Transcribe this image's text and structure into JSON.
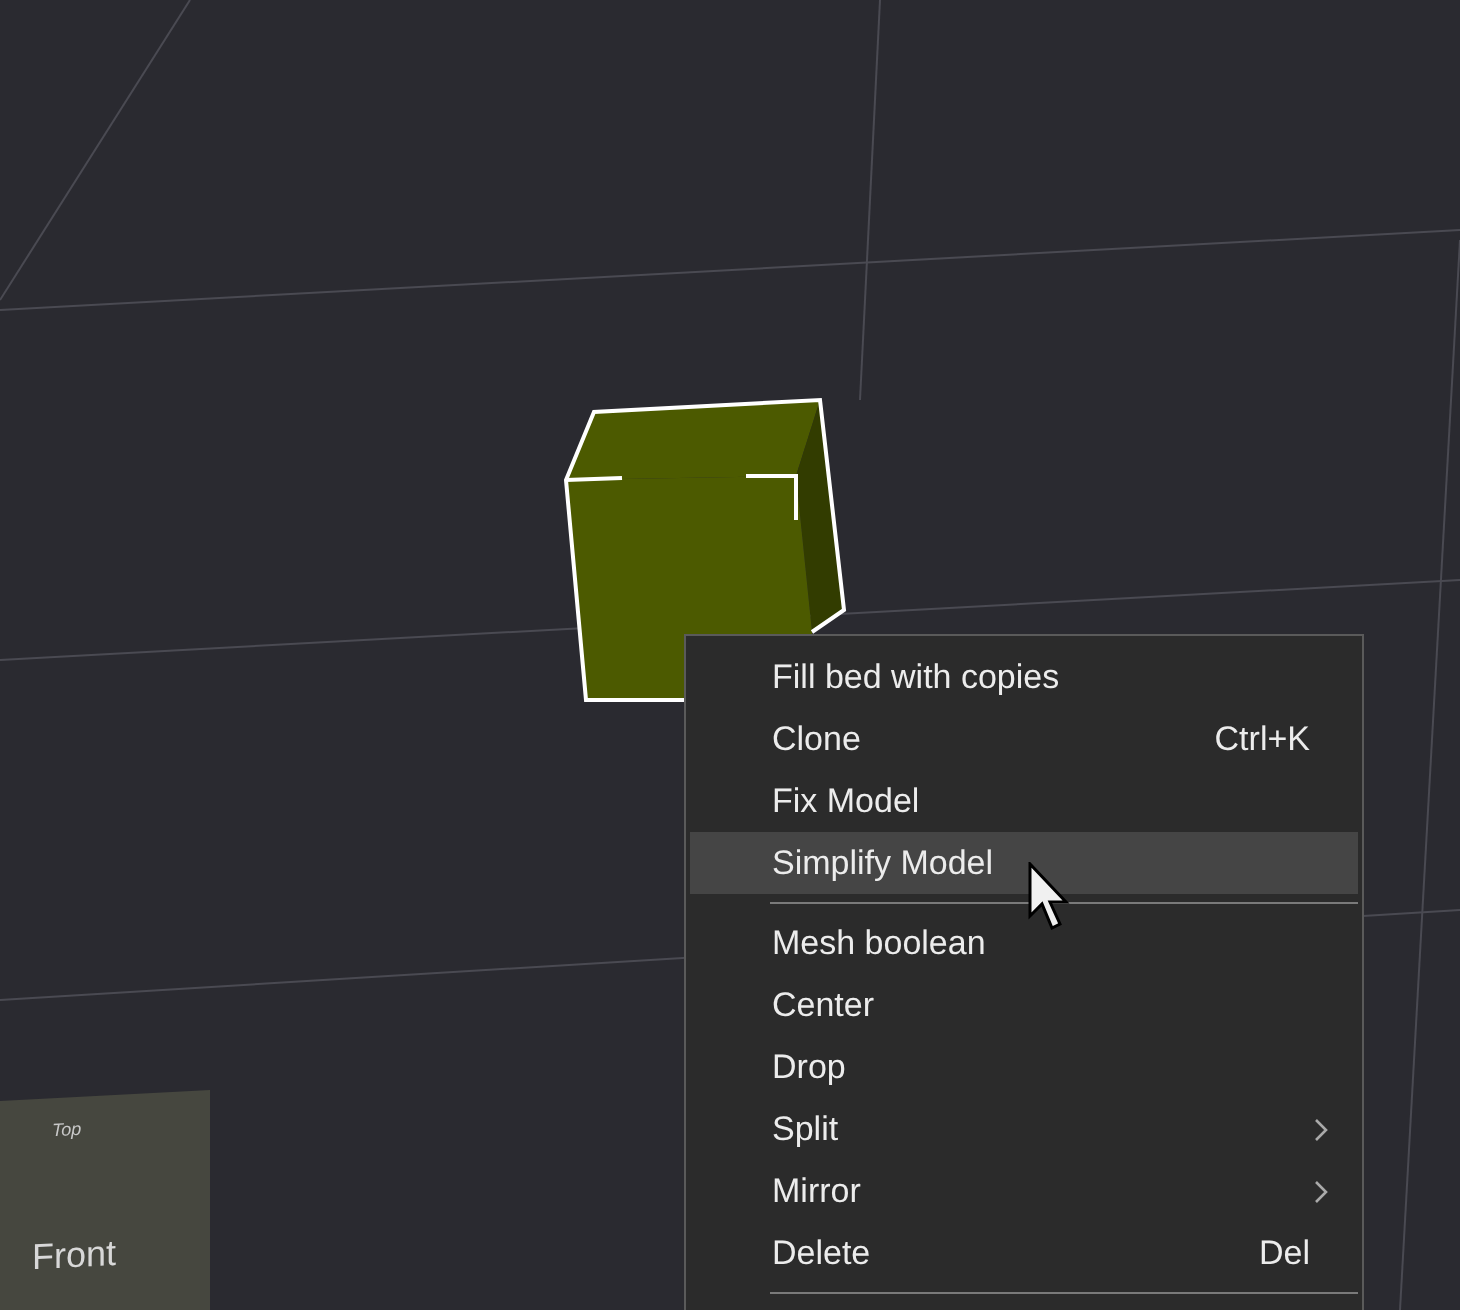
{
  "view_cube": {
    "front_label": "Front",
    "top_label": "Top"
  },
  "context_menu": {
    "items": [
      {
        "kind": "item",
        "label": "Fill bed with copies",
        "selected": false
      },
      {
        "kind": "item",
        "label": "Clone",
        "shortcut": "Ctrl+K",
        "selected": false
      },
      {
        "kind": "item",
        "label": "Fix Model",
        "selected": false
      },
      {
        "kind": "item",
        "label": "Simplify Model",
        "selected": true
      },
      {
        "kind": "separator"
      },
      {
        "kind": "item",
        "label": "Mesh boolean",
        "selected": false
      },
      {
        "kind": "item",
        "label": "Center",
        "selected": false
      },
      {
        "kind": "item",
        "label": "Drop",
        "selected": false
      },
      {
        "kind": "item",
        "label": "Split",
        "submenu": true,
        "selected": false
      },
      {
        "kind": "item",
        "label": "Mirror",
        "submenu": true,
        "selected": false
      },
      {
        "kind": "item",
        "label": "Delete",
        "shortcut": "Del",
        "selected": false
      },
      {
        "kind": "separator"
      }
    ]
  }
}
